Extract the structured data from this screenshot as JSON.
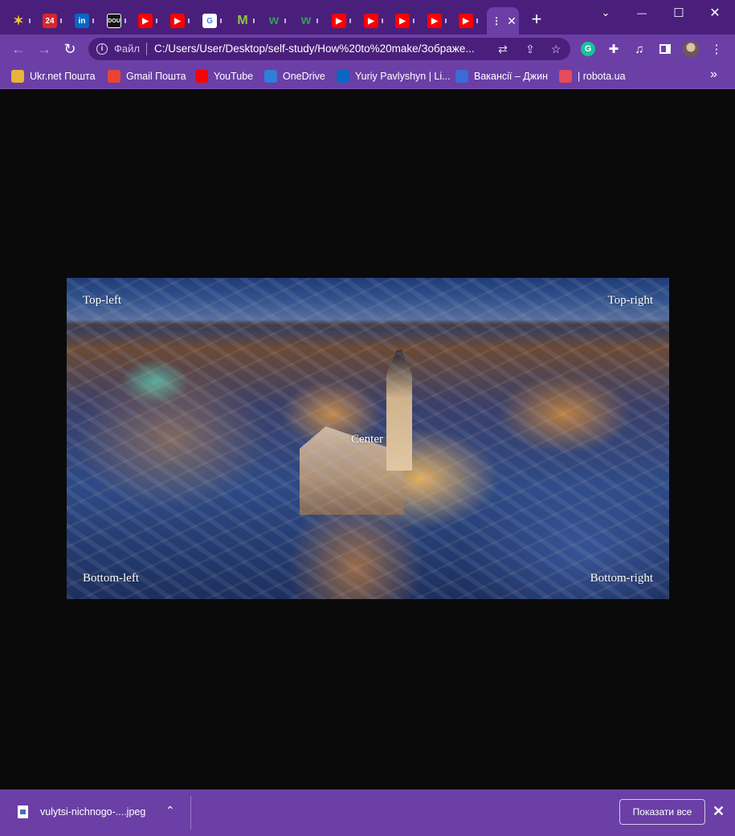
{
  "tabs": [
    {
      "name": "tab-pinwheel",
      "icon": "pinwheel-icon",
      "color": "#4a1f7c",
      "glyph": "✶"
    },
    {
      "name": "tab-24",
      "icon": "channel-24-icon",
      "color": "#d7262e",
      "glyph": "24"
    },
    {
      "name": "tab-linkedin",
      "icon": "linkedin-icon",
      "color": "#0a66c2",
      "glyph": "in"
    },
    {
      "name": "tab-dou",
      "icon": "dou-icon",
      "color": "#111111",
      "glyph": "DOU"
    },
    {
      "name": "tab-youtube-1",
      "icon": "youtube-icon",
      "color": "#ff0000",
      "glyph": "▶"
    },
    {
      "name": "tab-youtube-2",
      "icon": "youtube-icon",
      "color": "#ff0000",
      "glyph": "▶"
    },
    {
      "name": "tab-google",
      "icon": "google-icon",
      "color": "#ffffff",
      "glyph": "G"
    },
    {
      "name": "tab-m",
      "icon": "m-logo-icon",
      "color": "#8dc63f",
      "glyph": "M"
    },
    {
      "name": "tab-w-1",
      "icon": "w-logo-icon",
      "color": "#2e9e5b",
      "glyph": "w"
    },
    {
      "name": "tab-w-2",
      "icon": "w-logo-icon",
      "color": "#2e9e5b",
      "glyph": "w"
    },
    {
      "name": "tab-youtube-3",
      "icon": "youtube-icon",
      "color": "#ff0000",
      "glyph": "▶"
    },
    {
      "name": "tab-youtube-4",
      "icon": "youtube-icon",
      "color": "#ff0000",
      "glyph": "▶"
    },
    {
      "name": "tab-youtube-5",
      "icon": "youtube-icon",
      "color": "#ff0000",
      "glyph": "▶"
    },
    {
      "name": "tab-youtube-6",
      "icon": "youtube-icon",
      "color": "#ff0000",
      "glyph": "▶"
    },
    {
      "name": "tab-youtube-7",
      "icon": "youtube-icon",
      "color": "#ff0000",
      "glyph": "▶"
    }
  ],
  "active_tab": {
    "close_glyph": "✕"
  },
  "new_tab_glyph": "+",
  "window": {
    "minimize": "⌄",
    "restore": "—",
    "maximize": "☐",
    "close": "✕"
  },
  "toolbar": {
    "back": "←",
    "forward": "→",
    "reload": "↻",
    "file_label": "Файл",
    "url": "C:/Users/User/Desktop/self-study/How%20to%20make/Зображе..."
  },
  "bookmarks": [
    {
      "label": "Ukr.net Пошта",
      "icon": "ukrnet-icon",
      "color": "#e8b43a"
    },
    {
      "label": "Gmail Пошта",
      "icon": "gmail-icon",
      "color": "#ea4335"
    },
    {
      "label": "YouTube",
      "icon": "youtube-icon",
      "color": "#ff0000"
    },
    {
      "label": "OneDrive",
      "icon": "onedrive-icon",
      "color": "#2f7ed8"
    },
    {
      "label": "Yuriy Pavlyshyn | Li...",
      "icon": "linkedin-icon",
      "color": "#0a66c2"
    },
    {
      "label": "Вакансії – Джин",
      "icon": "djinni-icon",
      "color": "#3b6bd6"
    },
    {
      "label": "| robota.ua",
      "icon": "robota-icon",
      "color": "#e64a5b"
    }
  ],
  "bookmarks_more": "»",
  "image_captions": {
    "top_left": "Top-left",
    "top_right": "Top-right",
    "center": "Center",
    "bottom_left": "Bottom-left",
    "bottom_right": "Bottom-right"
  },
  "download": {
    "filename": "vulytsi-nichnogo-....jpeg",
    "chevron": "⌃",
    "show_all": "Показати все",
    "close": "✕"
  }
}
